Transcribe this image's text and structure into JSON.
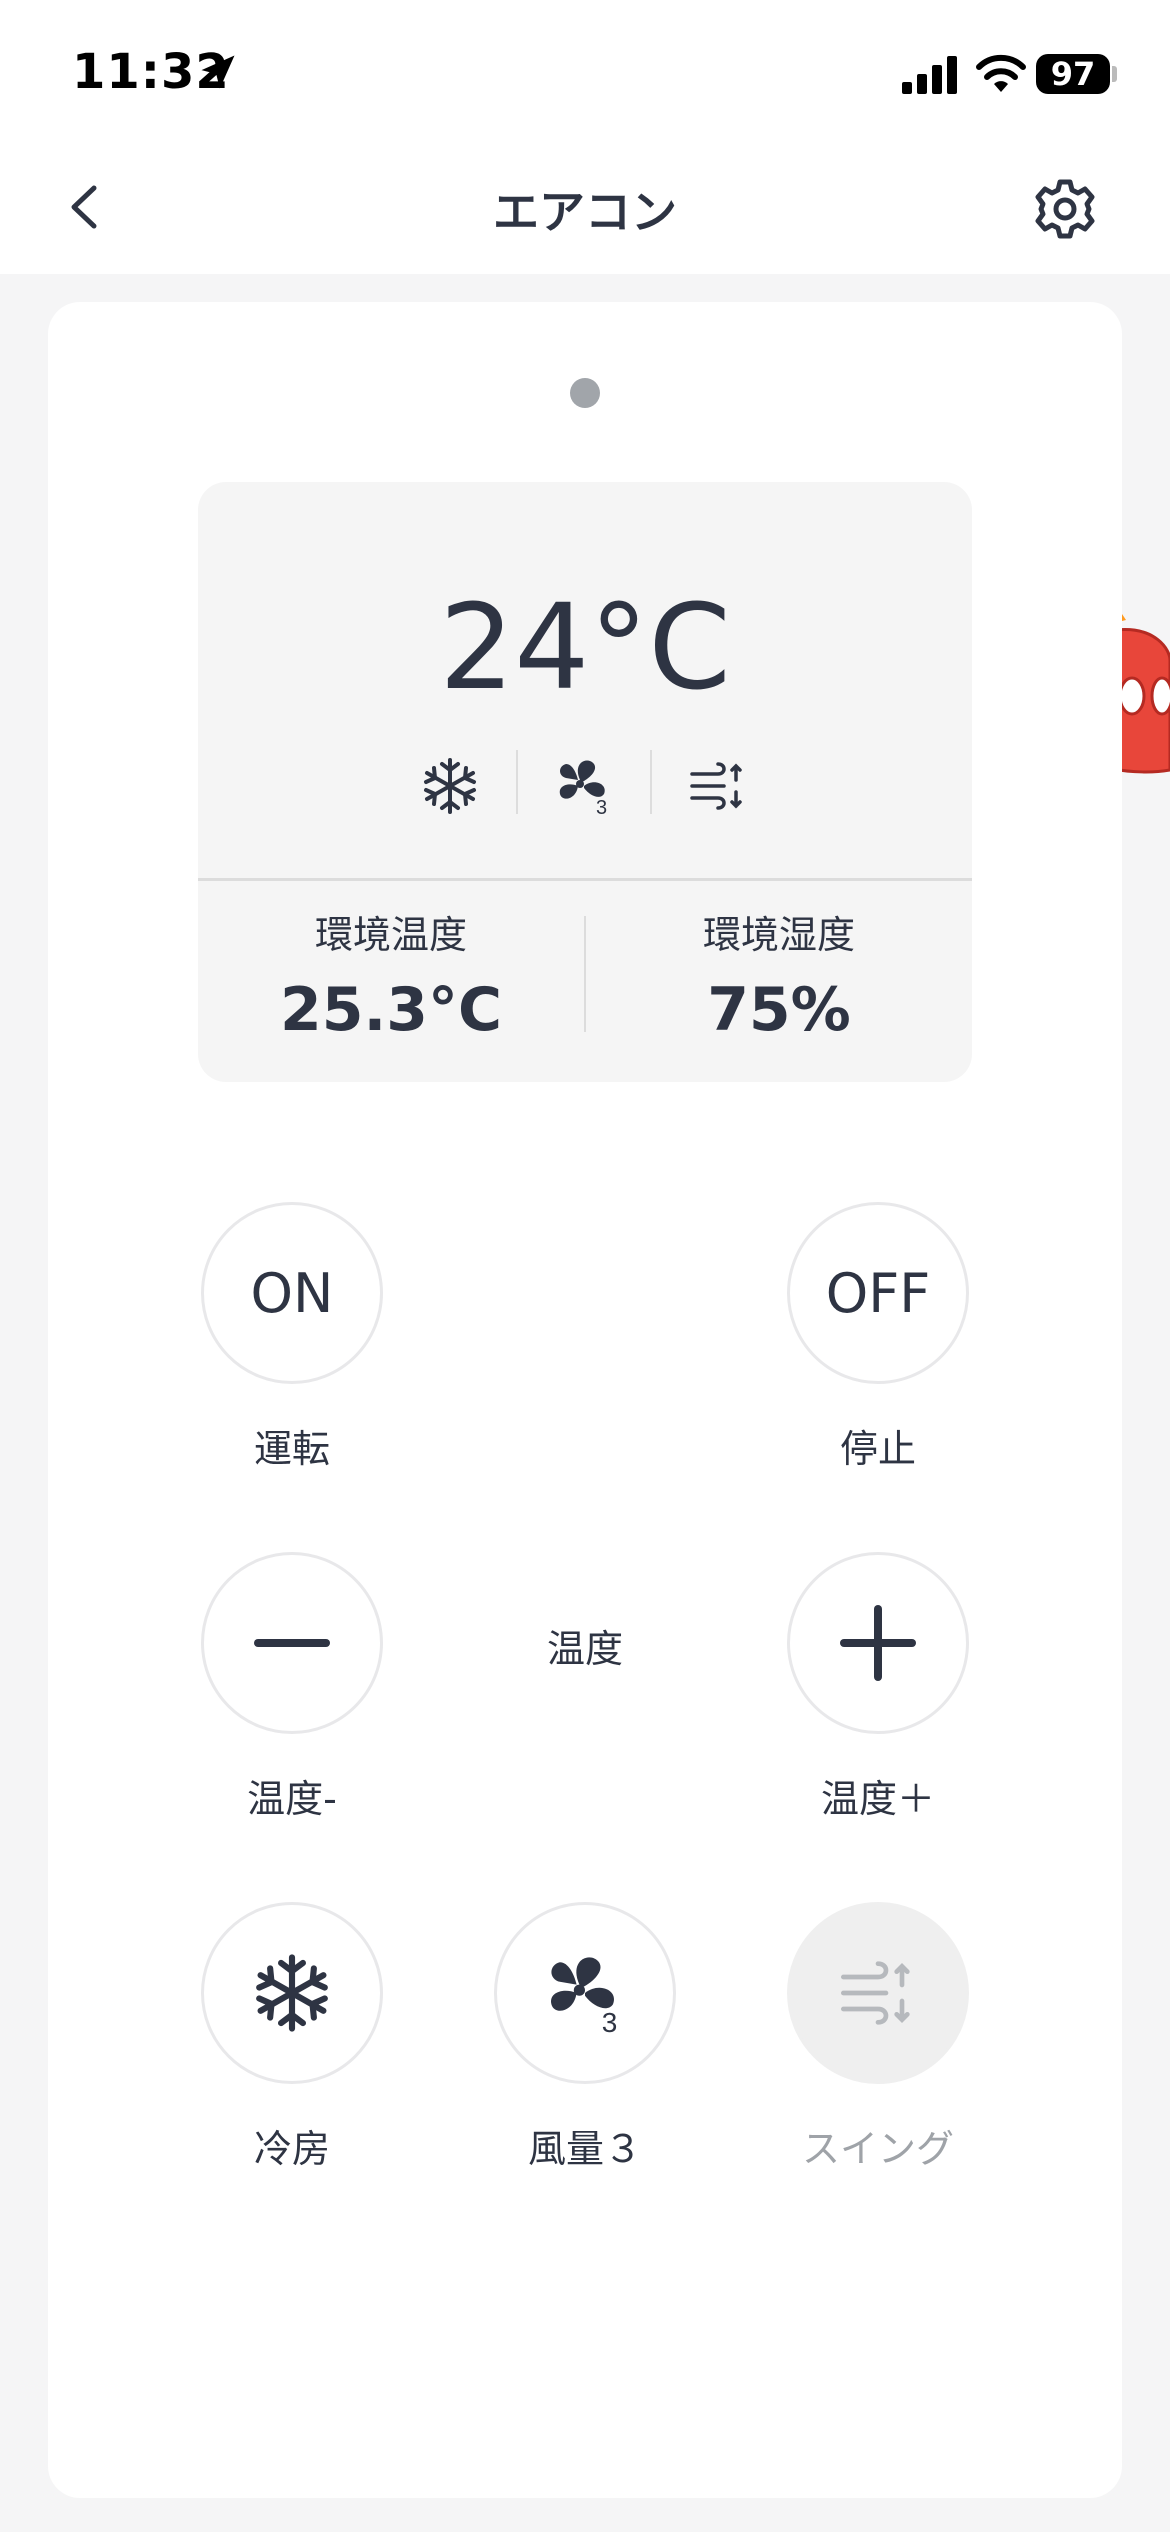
{
  "status_bar": {
    "time": "11:32",
    "battery": "97"
  },
  "nav": {
    "title": "エアコン"
  },
  "display": {
    "set_temperature": "24°C",
    "mode_icons": [
      "snowflake-icon",
      "fan-speed-3-icon",
      "swing-icon"
    ],
    "ambient_temp_label": "環境温度",
    "ambient_temp_value": "25.3°C",
    "ambient_humidity_label": "環境湿度",
    "ambient_humidity_value": "75%"
  },
  "controls": {
    "on": {
      "text": "ON",
      "label": "運転"
    },
    "off": {
      "text": "OFF",
      "label": "停止"
    },
    "temp_down": {
      "label": "温度-"
    },
    "temp_title": "温度",
    "temp_up": {
      "label": "温度＋"
    },
    "cool": {
      "label": "冷房"
    },
    "fan": {
      "label": "風量３"
    },
    "swing": {
      "label": "スイング",
      "enabled": false
    }
  },
  "colors": {
    "text_primary": "#2e3443",
    "disabled_text": "#9fa3a8",
    "background": "#f5f5f6",
    "mascot": "#e8463a"
  }
}
